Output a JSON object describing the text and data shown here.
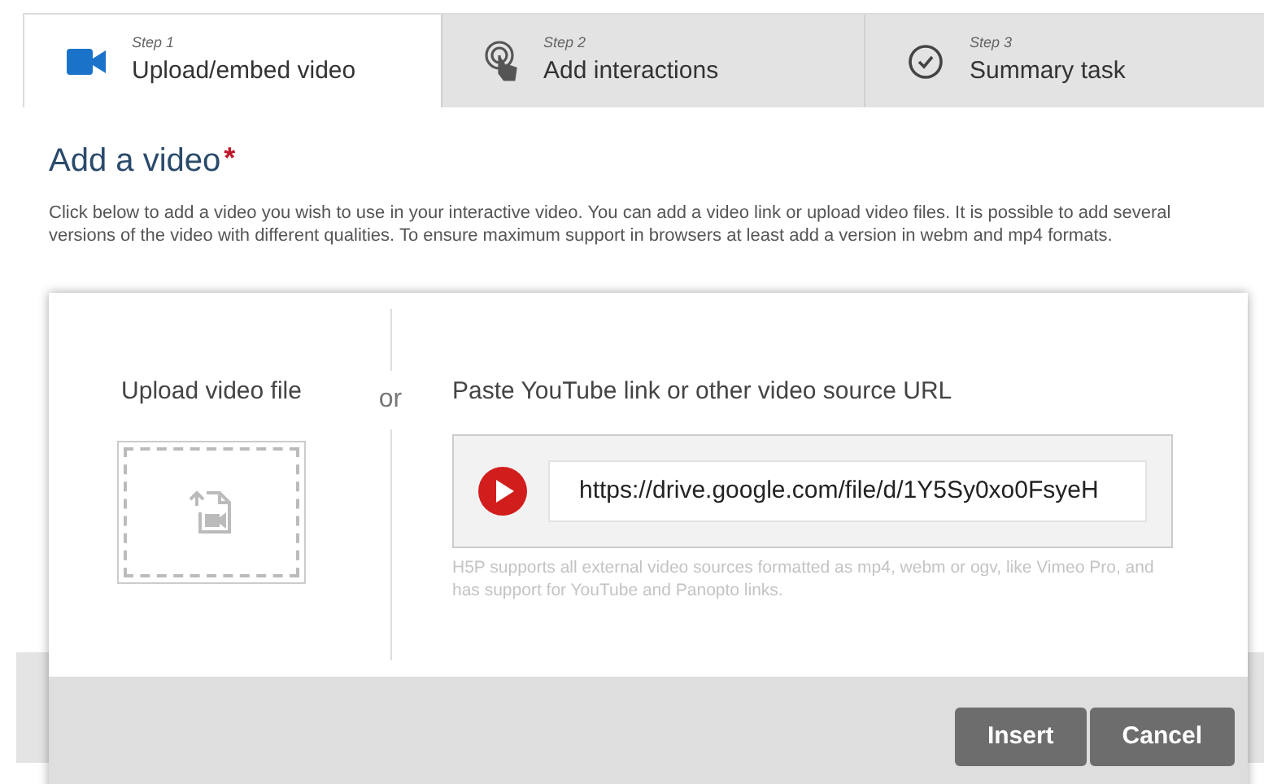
{
  "tabs": [
    {
      "step": "Step 1",
      "label": "Upload/embed video",
      "kind": "video",
      "selected": true
    },
    {
      "step": "Step 2",
      "label": "Add interactions",
      "kind": "touch",
      "selected": false
    },
    {
      "step": "Step 3",
      "label": "Summary task",
      "kind": "check",
      "selected": false
    }
  ],
  "section": {
    "title": "Add a video",
    "required_marker": "*",
    "description": "Click below to add a video you wish to use in your interactive video. You can add a video link or upload video files. It is possible to add several versions of the video with different qualities. To ensure maximum support in browsers at least add a version in webm and mp4 formats."
  },
  "dialog": {
    "upload_label": "Upload video file",
    "separator": "or",
    "url_label": "Paste YouTube link or other video source URL",
    "url_value": "https://drive.google.com/file/d/1Y5Sy0xo0FsyeH",
    "hint": "H5P supports all external video sources formatted as mp4, webm or ogv, like Vimeo Pro, and has support for YouTube and Panopto links.",
    "buttons": [
      "Insert",
      "Cancel"
    ]
  }
}
